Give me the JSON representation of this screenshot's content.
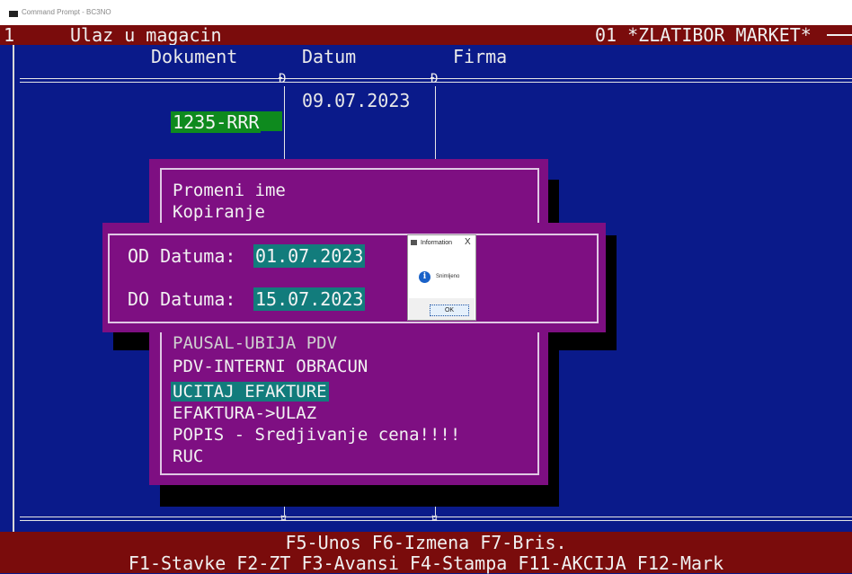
{
  "window": {
    "title": "Command Prompt - BC3NO"
  },
  "top_bar": {
    "row": "1",
    "screen_title": "Ulaz u magacin",
    "company": "01 *ZLATIBOR MARKET*"
  },
  "columns": {
    "dokument": "Dokument",
    "datum": "Datum",
    "firma": "Firma"
  },
  "record": {
    "dokument": "1235-RRR",
    "datum": "09.07.2023"
  },
  "menu": {
    "items": [
      {
        "label": "Promeni ime"
      },
      {
        "label": "Kopiranje"
      },
      {
        "label": "PAUSAL-UBIJA PDV"
      },
      {
        "label": "PDV-INTERNI OBRACUN"
      },
      {
        "label": "UCITAJ EFAKTURE",
        "selected": true
      },
      {
        "label": "EFAKTURA->ULAZ"
      },
      {
        "label": "POPIS - Sredjivanje cena!!!!"
      },
      {
        "label": "RUC"
      }
    ]
  },
  "date_dialog": {
    "od_label": "OD Datuma:",
    "od_value": "01.07.2023",
    "do_label": "DO Datuma:",
    "do_value": "15.07.2023"
  },
  "message_box": {
    "title": "Information",
    "close": "X",
    "icon": "info-icon",
    "text": "Snimljeno",
    "ok_label": "OK"
  },
  "bottom_bar": {
    "line1": "F5-Unos F6-Izmena F7-Bris.",
    "line2": "F1-Stavke F2-ZT F3-Avansi F4-Stampa F11-AKCIJA F12-Mark"
  },
  "colors": {
    "background": "#0a1a8a",
    "bar": "#7a0c0c",
    "menu": "#7e0f82",
    "highlight": "#127c7c",
    "record_highlight": "#0e8a1e"
  }
}
